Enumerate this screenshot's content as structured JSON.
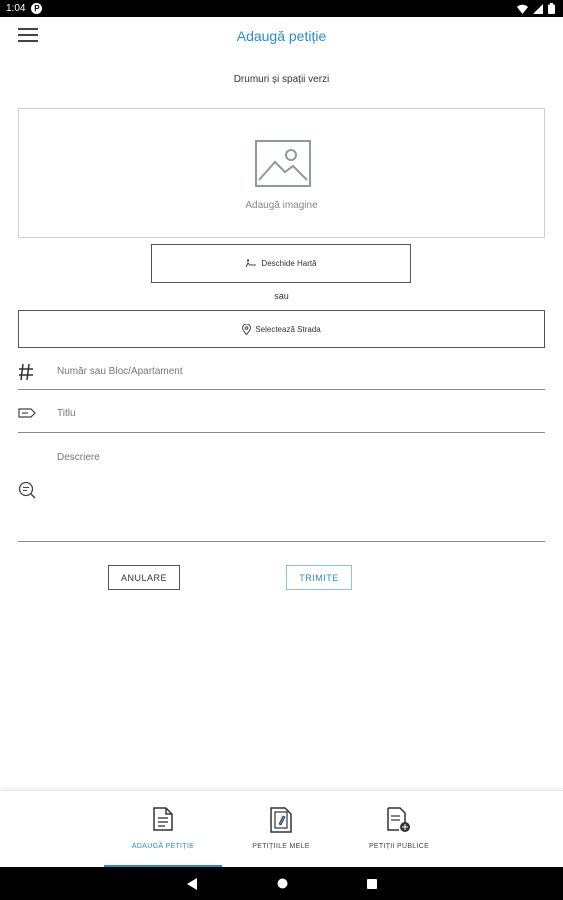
{
  "status_bar": {
    "time": "1:04",
    "app_icon_letter": "P"
  },
  "app_bar": {
    "title": "Adaugă petiție"
  },
  "form": {
    "category": "Drumuri și spații verzi",
    "add_image_label": "Adaugă imagine",
    "open_map_label": "Deschide Hartă",
    "or_label": "sau",
    "select_street_label": "Selectează Strada",
    "number_placeholder": "Număr sau Bloc/Apartament",
    "title_placeholder": "Titlu",
    "description_placeholder": "Descriere",
    "cancel_label": "ANULARE",
    "submit_label": "TRIMITE"
  },
  "bottom_nav": {
    "items": [
      {
        "label": "ADAUGĂ PETIȚIE",
        "icon": "document-icon",
        "active": true
      },
      {
        "label": "PETIȚIILE MELE",
        "icon": "edit-document-icon",
        "active": false
      },
      {
        "label": "PETIȚII PUBLICE",
        "icon": "public-document-icon",
        "active": false
      }
    ]
  },
  "colors": {
    "accent": "#2b8ccc",
    "border": "#cfcfcf"
  }
}
